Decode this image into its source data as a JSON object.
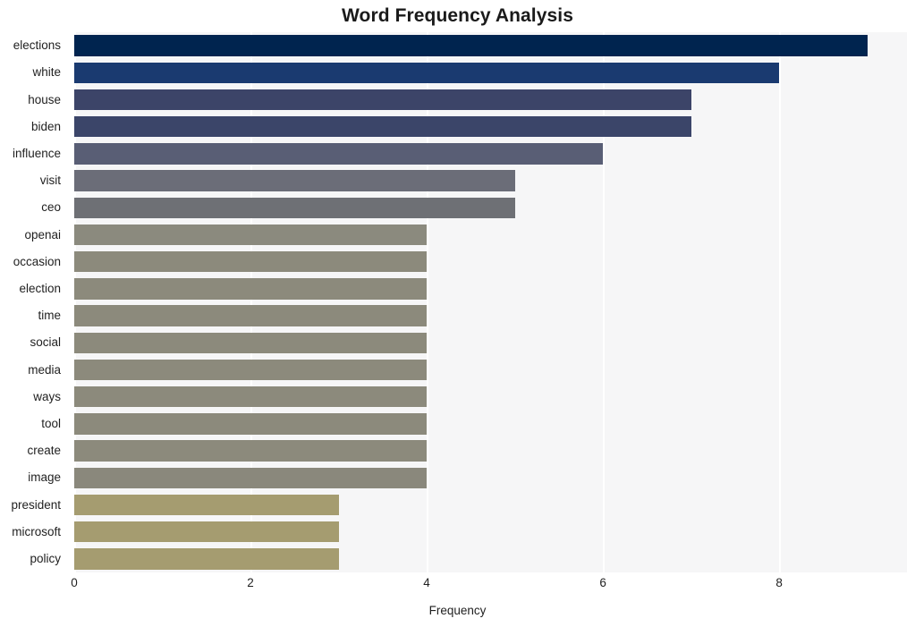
{
  "chart_data": {
    "type": "bar",
    "orientation": "horizontal",
    "title": "Word Frequency Analysis",
    "xlabel": "Frequency",
    "ylabel": "",
    "categories": [
      "elections",
      "white",
      "house",
      "biden",
      "influence",
      "visit",
      "ceo",
      "openai",
      "occasion",
      "election",
      "time",
      "social",
      "media",
      "ways",
      "tool",
      "create",
      "image",
      "president",
      "microsoft",
      "policy"
    ],
    "values": [
      9,
      8,
      7,
      7,
      6,
      5,
      5,
      4,
      4,
      4,
      4,
      4,
      4,
      4,
      4,
      4,
      4,
      3,
      3,
      3
    ],
    "bar_colors": [
      "#00244f",
      "#1a3a70",
      "#3c4468",
      "#3b4569",
      "#595e75",
      "#6b6d78",
      "#6e7075",
      "#8b8a7e",
      "#8c8a7c",
      "#8c8a7c",
      "#8c8a7c",
      "#8c8a7c",
      "#8c8a7c",
      "#8c8a7c",
      "#8c8a7c",
      "#8c8a7c",
      "#8a887c",
      "#a59c70",
      "#a59c70",
      "#a59c70"
    ],
    "xlim": [
      0,
      9.45
    ],
    "xticks": [
      0,
      2,
      4,
      6,
      8
    ],
    "xtick_labels": [
      "0",
      "2",
      "4",
      "6",
      "8"
    ],
    "grid": true,
    "gridline_color": "#ffffff",
    "plot_background": "#f6f6f7",
    "figure_background": "#ffffff",
    "legend": null
  }
}
